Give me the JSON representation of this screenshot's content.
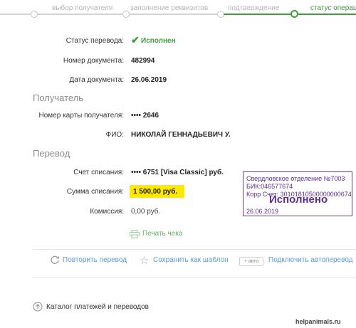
{
  "steps": {
    "items": [
      {
        "label": "выбор получателя"
      },
      {
        "label": "заполнение реквизитов"
      },
      {
        "label": "подтверждение"
      },
      {
        "label": "статус операции"
      }
    ]
  },
  "transfer": {
    "status_label": "Статус перевода:",
    "status_value": "Исполнен",
    "doc_number_label": "Номер документа:",
    "doc_number": "482994",
    "doc_date_label": "Дата документа:",
    "doc_date": "26.06.2019"
  },
  "recipient": {
    "section_title": "Получатель",
    "card_label": "Номер карты получателя:",
    "card_value": "•••• 2646",
    "name_label": "ФИО:",
    "name_value": "НИКОЛАЙ ГЕННАДЬЕВИЧ У."
  },
  "payment": {
    "section_title": "Перевод",
    "account_label": "Счет списания:",
    "account_value": "•••• 6751  [Visa Classic]  руб.",
    "amount_label": "Сумма списания:",
    "amount_value": "1 500,00  руб.",
    "fee_label": "Комиссия:",
    "fee_value": "0,00 руб."
  },
  "actions": {
    "print": "Печать чека",
    "repeat": "Повторить перевод",
    "save_template": "Сохранить как шаблон",
    "auto_badge": "+ авто",
    "autopay": "Подключить автоперевод",
    "catalog": "Каталог платежей и переводов"
  },
  "stamp": {
    "line1": "Свердловское отделение №7003",
    "line2": "БИК:046577674",
    "line3": "Корр Счет: 30101810500000000674",
    "big": "Исполнено",
    "date": "26.06.2019"
  },
  "watermark": "helpanimals.ru",
  "colors": {
    "accent": "#3f9d3c",
    "highlight": "#ffe800",
    "stamp": "#5b2e8f",
    "link": "#5c9ad1"
  }
}
